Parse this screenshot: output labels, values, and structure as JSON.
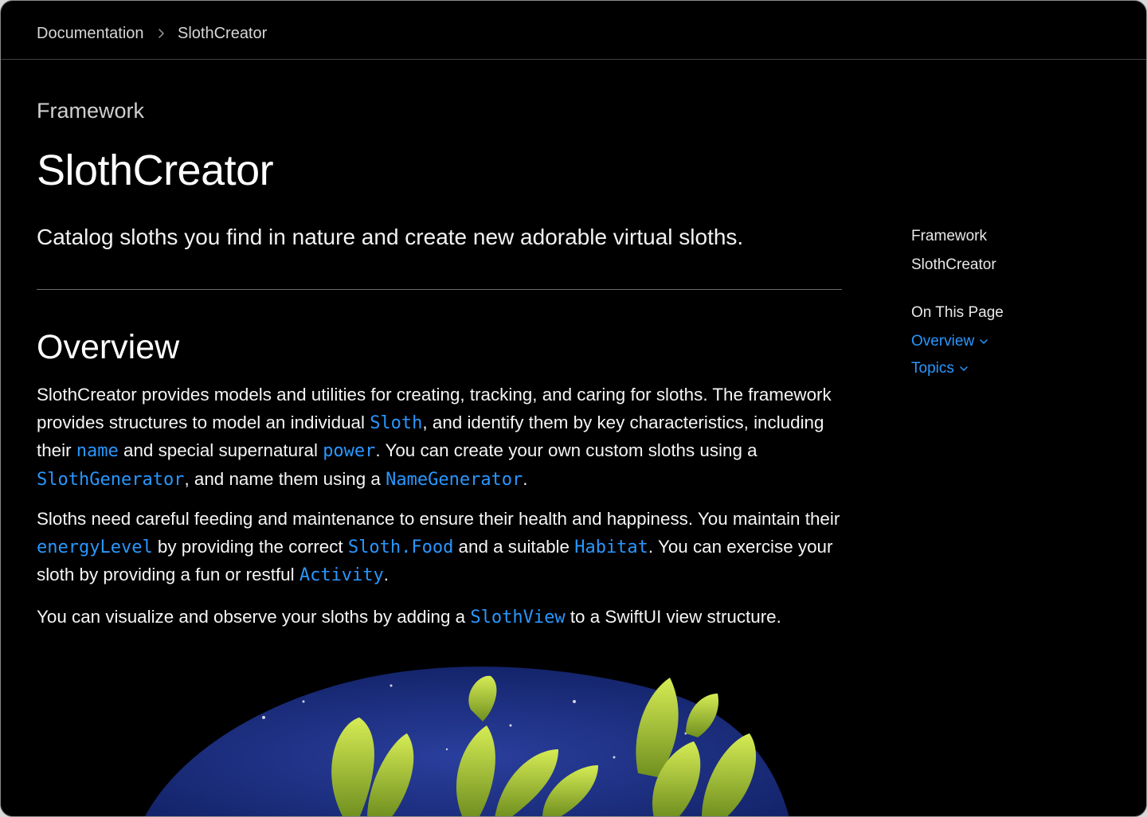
{
  "breadcrumb": {
    "items": [
      "Documentation",
      "SlothCreator"
    ]
  },
  "eyebrow": "Framework",
  "title": "SlothCreator",
  "abstract": "Catalog sloths you find in nature and create new adorable virtual sloths.",
  "overview": {
    "heading": "Overview",
    "p1": {
      "t1": "SlothCreator provides models and utilities for creating, tracking, and caring for sloths. The framework provides structures to model an individual ",
      "c1": "Sloth",
      "t2": ", and identify them by key characteristics, including their ",
      "c2": "name",
      "t3": " and special supernatural ",
      "c3": "power",
      "t4": ". You can create your own custom sloths using a ",
      "c4": "SlothGenerator",
      "t5": ", and name them using a ",
      "c5": "NameGenerator",
      "t6": "."
    },
    "p2": {
      "t1": "Sloths need careful feeding and maintenance to ensure their health and happiness. You maintain their ",
      "c1": "energyLevel",
      "t2": " by providing the correct ",
      "c2": "Sloth.Food",
      "t3": " and a suitable ",
      "c3": "Habitat",
      "t4": ". You can exercise your sloth by providing a fun or restful ",
      "c4": "Activity",
      "t5": "."
    },
    "p3": {
      "t1": "You can visualize and observe your sloths by adding a ",
      "c1": "SlothView",
      "t2": " to a SwiftUI view structure."
    }
  },
  "sidebar": {
    "kind": "Framework",
    "name": "SlothCreator",
    "on_this_page": "On This Page",
    "links": [
      "Overview",
      "Topics"
    ]
  },
  "colors": {
    "background": "#000000",
    "link": "#2997ff",
    "leaf": "#a8c93a",
    "planet": "#1c2f8a"
  }
}
